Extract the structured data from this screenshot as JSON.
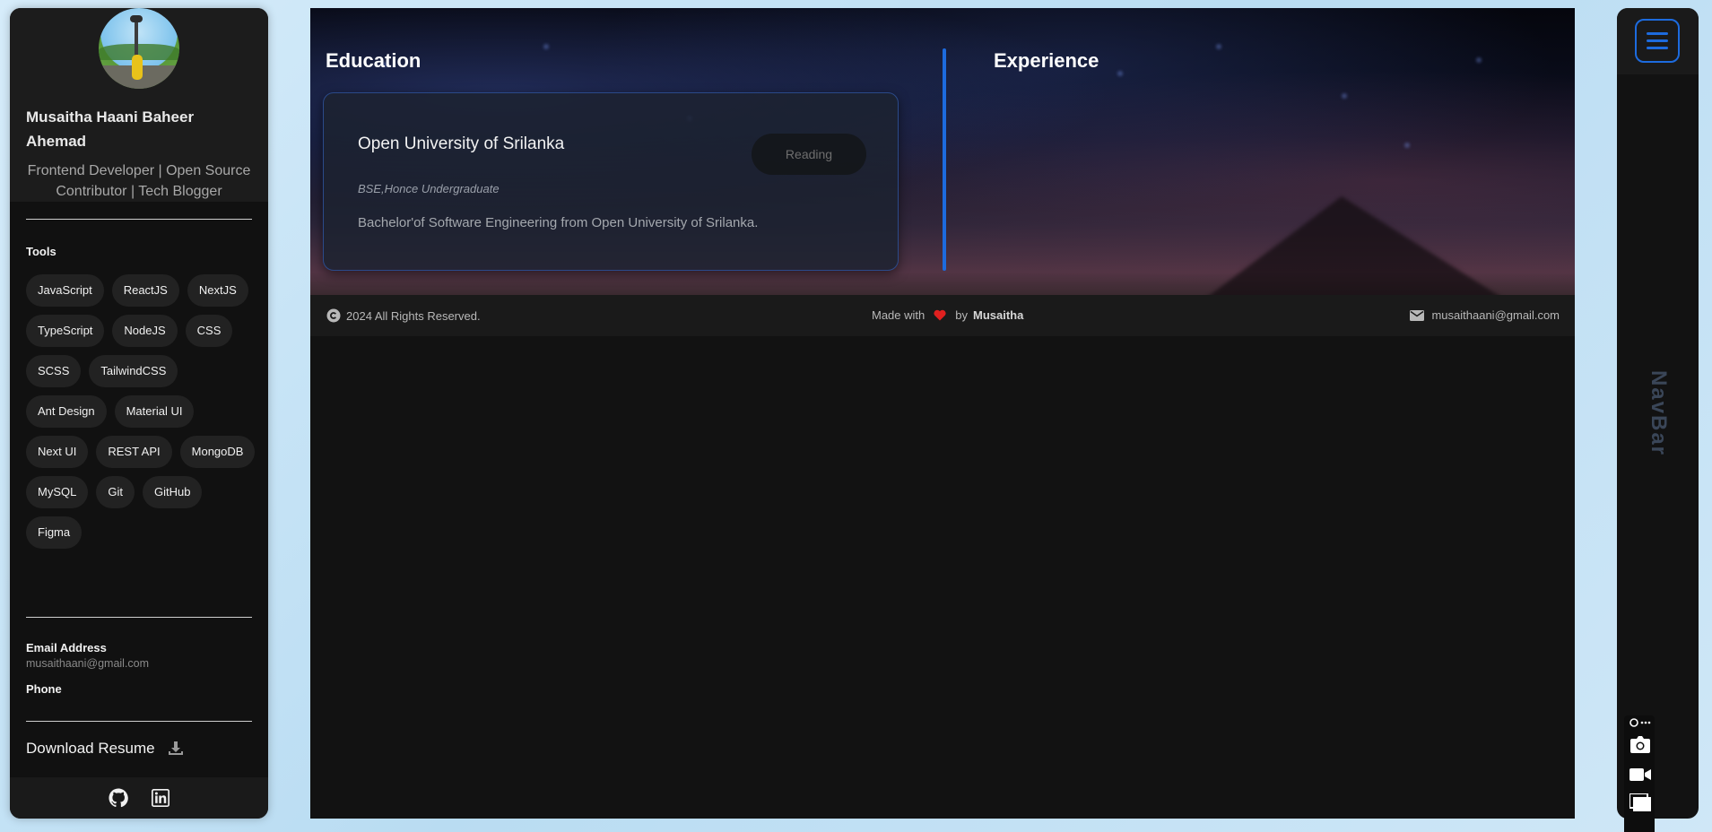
{
  "profile": {
    "name": "Musaitha Haani Baheer Ahemad",
    "role": "Frontend Developer | Open Source Contributor | Tech Blogger"
  },
  "tools": {
    "heading": "Tools",
    "items": [
      "JavaScript",
      "ReactJS",
      "NextJS",
      "TypeScript",
      "NodeJS",
      "CSS",
      "SCSS",
      "TailwindCSS",
      "Ant Design",
      "Material UI",
      "Next UI",
      "REST API",
      "MongoDB",
      "MySQL",
      "Git",
      "GitHub",
      "Figma"
    ]
  },
  "contact": {
    "email_label": "Email Address",
    "email_value": "musaithaani@gmail.com",
    "phone_label": "Phone"
  },
  "download": {
    "label": "Download Resume"
  },
  "education": {
    "heading": "Education",
    "card": {
      "title": "Open University of Srilanka",
      "badge": "Reading",
      "degree": "BSE,Honce Undergraduate",
      "description": "Bachelor'of Software Engineering from Open University of Srilanka."
    }
  },
  "experience": {
    "heading": "Experience"
  },
  "footer": {
    "copyright": "2024 All Rights Reserved.",
    "made_with": "Made with",
    "by": "by",
    "author": "Musaitha",
    "email": "musaithaani@gmail.com"
  },
  "navbar": {
    "label": "NavBar"
  },
  "colors": {
    "accent": "#1d6bde",
    "heart": "#e0201f",
    "sidebar_bg": "#111111",
    "main_bg": "#121212"
  },
  "icons": [
    "github-icon",
    "linkedin-icon",
    "download-icon",
    "copyright-icon",
    "heart-icon",
    "mail-icon",
    "hamburger-menu-icon",
    "camera-icon",
    "video-icon",
    "window-icon"
  ]
}
